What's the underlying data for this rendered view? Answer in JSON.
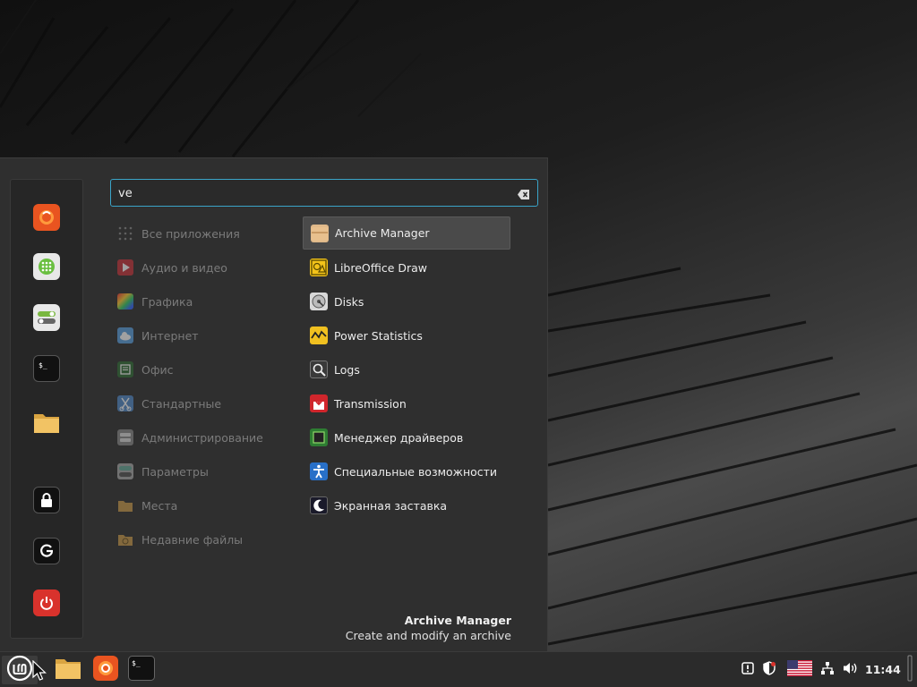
{
  "search": {
    "value": "ve"
  },
  "categories": [
    {
      "label": "Все приложения",
      "icon": "all-apps-icon"
    },
    {
      "label": "Аудио и видео",
      "icon": "multimedia-icon"
    },
    {
      "label": "Графика",
      "icon": "graphics-icon"
    },
    {
      "label": "Интернет",
      "icon": "internet-icon"
    },
    {
      "label": "Офис",
      "icon": "office-icon"
    },
    {
      "label": "Стандартные",
      "icon": "accessories-icon"
    },
    {
      "label": "Администрирование",
      "icon": "administration-icon"
    },
    {
      "label": "Параметры",
      "icon": "settings-icon"
    },
    {
      "label": "Места",
      "icon": "places-icon"
    },
    {
      "label": "Недавние файлы",
      "icon": "recent-files-icon"
    }
  ],
  "apps": [
    {
      "label": "Archive Manager",
      "icon": "archive-icon"
    },
    {
      "label": "LibreOffice Draw",
      "icon": "libreoffice-draw-icon"
    },
    {
      "label": "Disks",
      "icon": "disks-icon"
    },
    {
      "label": "Power Statistics",
      "icon": "power-statistics-icon"
    },
    {
      "label": "Logs",
      "icon": "logs-icon"
    },
    {
      "label": "Transmission",
      "icon": "transmission-icon"
    },
    {
      "label": "Менеджер драйверов",
      "icon": "driver-manager-icon"
    },
    {
      "label": "Специальные возможности",
      "icon": "accessibility-icon"
    },
    {
      "label": "Экранная заставка",
      "icon": "screensaver-icon"
    }
  ],
  "info": {
    "title": "Archive Manager",
    "description": "Create and modify an archive"
  },
  "favorites": [
    "firefox-icon",
    "software-manager-icon",
    "system-settings-icon",
    "terminal-icon",
    "files-icon",
    "lock-icon",
    "logout-icon",
    "power-icon"
  ],
  "panel": {
    "clock": "11:44"
  },
  "colors": {
    "accent": "#3aa4c8",
    "menu_bg": "#2f2f2f",
    "selected_bg": "#4a4a4a"
  }
}
